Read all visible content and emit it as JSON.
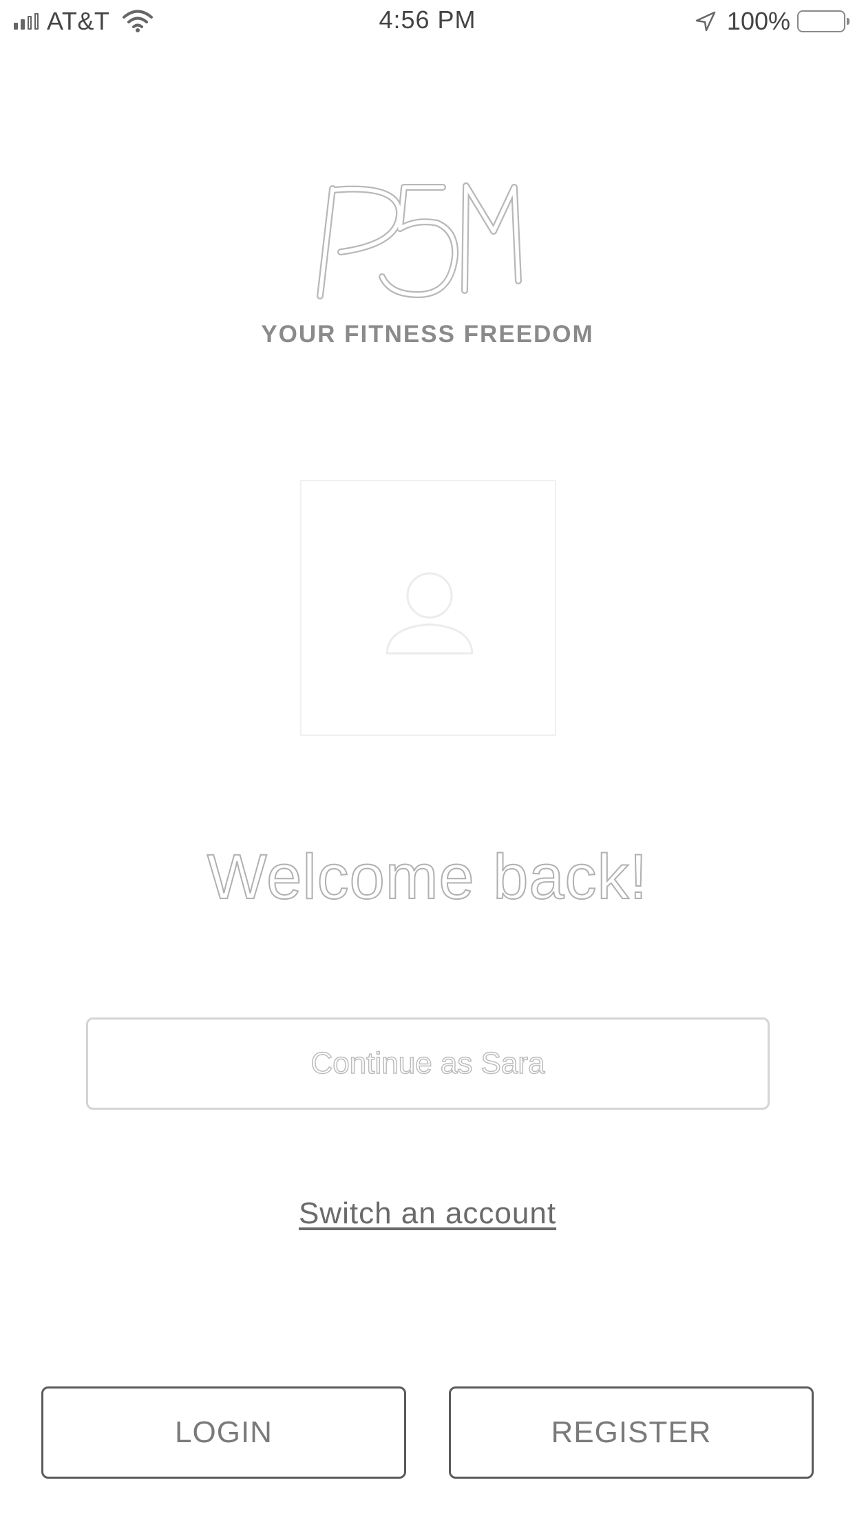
{
  "status_bar": {
    "carrier": "AT&T",
    "time": "4:56 PM",
    "battery_percent": "100%",
    "signal_bars_filled": 2,
    "signal_bars_total": 4,
    "icons": [
      "signal-icon",
      "wifi-icon",
      "location-arrow-icon",
      "battery-icon"
    ]
  },
  "brand": {
    "logo_text": "P5M",
    "tagline": "YOUR FITNESS FREEDOM"
  },
  "avatar": {
    "icon": "user-placeholder-icon"
  },
  "welcome": {
    "heading": "Welcome back!"
  },
  "actions": {
    "continue_label": "Continue as Sara",
    "switch_account_label": "Switch an account",
    "login_label": "LOGIN",
    "register_label": "REGISTER"
  },
  "colors": {
    "background": "#ffffff",
    "text_muted": "#8a8a8a",
    "button_border": "#5a5a5a",
    "continue_border": "#d4d4d4"
  }
}
